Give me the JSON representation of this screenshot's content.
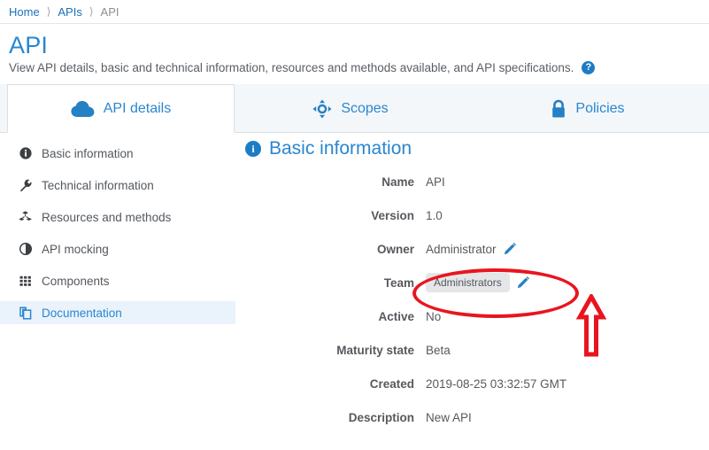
{
  "breadcrumb": {
    "items": [
      {
        "label": "Home",
        "current": false
      },
      {
        "label": "APIs",
        "current": false
      },
      {
        "label": "API",
        "current": true
      }
    ],
    "separator": "⟩"
  },
  "header": {
    "title": "API",
    "description": "View API details, basic and technical information, resources and methods available, and API specifications.",
    "help_icon": "help-circle-icon",
    "help_glyph": "?"
  },
  "tabs": [
    {
      "label": "API details",
      "icon": "cloud-icon",
      "active": true
    },
    {
      "label": "Scopes",
      "icon": "crosshair-icon",
      "active": false
    },
    {
      "label": "Policies",
      "icon": "lock-icon",
      "active": false
    }
  ],
  "sidebar": {
    "items": [
      {
        "label": "Basic information",
        "icon": "info-circle-icon",
        "active": false
      },
      {
        "label": "Technical information",
        "icon": "wrench-icon",
        "active": false
      },
      {
        "label": "Resources and methods",
        "icon": "cubes-icon",
        "active": false
      },
      {
        "label": "API mocking",
        "icon": "contrast-circle-icon",
        "active": false
      },
      {
        "label": "Components",
        "icon": "grid-icon",
        "active": false
      },
      {
        "label": "Documentation",
        "icon": "copy-pages-icon",
        "active": true
      }
    ]
  },
  "main": {
    "section_title": "Basic information",
    "section_icon": "info-circle-icon",
    "section_icon_glyph": "i",
    "fields": [
      {
        "label": "Name",
        "value": "API",
        "badge": false,
        "editable": false
      },
      {
        "label": "Version",
        "value": "1.0",
        "badge": false,
        "editable": false
      },
      {
        "label": "Owner",
        "value": "Administrator",
        "badge": false,
        "editable": true
      },
      {
        "label": "Team",
        "value": "Administrators",
        "badge": true,
        "editable": true
      },
      {
        "label": "Active",
        "value": "No",
        "badge": false,
        "editable": false
      },
      {
        "label": "Maturity state",
        "value": "Beta",
        "badge": false,
        "editable": false
      },
      {
        "label": "Created",
        "value": "2019-08-25 03:32:57 GMT",
        "badge": false,
        "editable": false
      },
      {
        "label": "Description",
        "value": "New API",
        "badge": false,
        "editable": false
      }
    ]
  },
  "annotations": {
    "highlight_ellipse": {
      "target": "team-field-row",
      "color": "#e8151f"
    },
    "arrow": {
      "target": "team-edit-pencil",
      "direction": "up",
      "color": "#e8151f"
    }
  },
  "colors": {
    "accent_blue": "#2a86d0",
    "icon_blue": "#1c7cc4",
    "link_blue": "#1c71b8",
    "annotation_red": "#e8151f",
    "active_sidebar_bg": "#eaf3fb",
    "tabbar_bg": "#f3f7fa",
    "badge_bg": "#e4e6e8"
  }
}
